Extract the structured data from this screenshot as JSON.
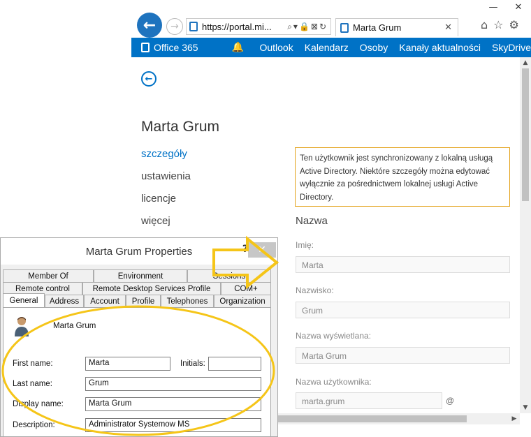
{
  "browser": {
    "url": "https://portal.mi...",
    "address_tools": "⌕▾🔒⊠↻",
    "tab_title": "Marta Grum",
    "tab_close": "✕",
    "win_minimize": "—",
    "win_close": "✕",
    "icons": [
      "home-icon",
      "star-icon",
      "gear-icon"
    ]
  },
  "o365": {
    "logo": "Office 365",
    "nav": [
      "Outlook",
      "Kalendarz",
      "Osoby",
      "Kanały aktualności",
      "SkyDrive"
    ]
  },
  "page": {
    "user_name": "Marta Grum",
    "left_nav": [
      "szczegóły",
      "ustawienia",
      "licencje",
      "więcej"
    ],
    "sync_notice": "Ten użytkownik jest synchronizowany z lokalną usługą Active Directory. Niektóre szczegóły można edytować wyłącznie za pośrednictwem lokalnej usługi Active Directory.",
    "section_title": "Nazwa",
    "fields": [
      {
        "label": "Imię:",
        "value": "Marta"
      },
      {
        "label": "Nazwisko:",
        "value": "Grum"
      },
      {
        "label": "Nazwa wyświetlana:",
        "value": "Marta Grum"
      },
      {
        "label": "Nazwa użytkownika:",
        "value": "marta.grum"
      }
    ],
    "at_sign": "@"
  },
  "dialog": {
    "title": "Marta Grum Properties",
    "help": "?",
    "close": "✕",
    "tabs_row1": [
      "Member Of",
      "Environment",
      "Sessions"
    ],
    "tabs_row2": [
      "Remote control",
      "Remote Desktop Services Profile",
      "COM+"
    ],
    "tabs_row3": [
      "General",
      "Address",
      "Account",
      "Profile",
      "Telephones",
      "Organization"
    ],
    "user_display": "Marta Grum",
    "first_name_label": "First name:",
    "first_name": "Marta",
    "initials_label": "Initials:",
    "initials": "",
    "last_name_label": "Last name:",
    "last_name": "Grum",
    "display_name_label": "Display name:",
    "display_name": "Marta Grum",
    "description_label": "Description:",
    "description": "Administrator Systemow MS"
  },
  "colors": {
    "o365_blue": "#0072c6",
    "notice_border": "#e3a21a",
    "annotation_yellow": "#f5c518"
  }
}
